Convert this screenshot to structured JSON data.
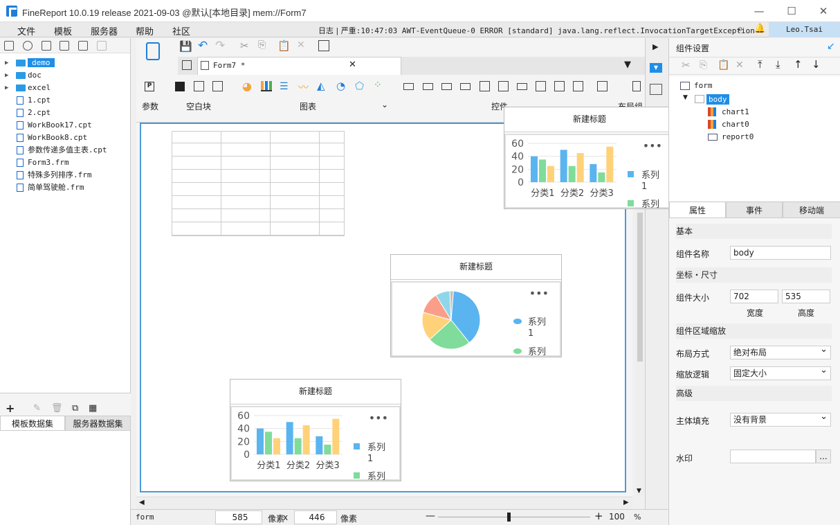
{
  "window": {
    "title": "FineReport 10.0.19 release 2021-09-03 @默认[本地目录]    mem://Form7"
  },
  "menu": [
    "文件",
    "模板",
    "服务器",
    "帮助",
    "社区"
  ],
  "log": {
    "label": "日志",
    "text": "严重:10:47:03 AWT-EventQueue-0 ERROR [standard] java.lang.reflect.InvocationTargetException"
  },
  "user": "Leo.Tsai",
  "tree": [
    {
      "name": "demo",
      "type": "folder",
      "selected": true
    },
    {
      "name": "doc",
      "type": "folder"
    },
    {
      "name": "excel",
      "type": "folder"
    },
    {
      "name": "1.cpt",
      "type": "cpt"
    },
    {
      "name": "2.cpt",
      "type": "cpt"
    },
    {
      "name": "WorkBook17.cpt",
      "type": "cpt"
    },
    {
      "name": "WorkBook8.cpt",
      "type": "cpt"
    },
    {
      "name": "参数传递多值主表.cpt",
      "type": "cpt"
    },
    {
      "name": "Form3.frm",
      "type": "frm"
    },
    {
      "name": "特殊多列排序.frm",
      "type": "frm"
    },
    {
      "name": "简单驾驶舱.frm",
      "type": "frm"
    }
  ],
  "datasets": {
    "template": "模板数据集",
    "server": "服务器数据集"
  },
  "tab": {
    "label": "Form7 *"
  },
  "groups": {
    "param": "参数",
    "blank": "空白块",
    "chart": "图表",
    "widget": "控件",
    "layout": "布局组"
  },
  "widgets": [
    {
      "title": "新建标题",
      "type": "bar",
      "yticks": [
        "60",
        "40",
        "20",
        "0"
      ],
      "categories": [
        "分类1",
        "分类2",
        "分类3"
      ],
      "legend": "系列1",
      "legend2": "系列"
    },
    {
      "title": "新建标题",
      "type": "pie",
      "legend": "系列1",
      "legend2": "系列"
    },
    {
      "title": "新建标题",
      "type": "bar",
      "yticks": [
        "60",
        "40",
        "20",
        "0"
      ],
      "categories": [
        "分类1",
        "分类2",
        "分类3"
      ],
      "legend": "系列1",
      "legend2": "系列"
    }
  ],
  "chart_data": [
    {
      "type": "bar",
      "title": "新建标题",
      "categories": [
        "分类1",
        "分类2",
        "分类3"
      ],
      "ylim": [
        0,
        60
      ],
      "series": [
        {
          "name": "系列1",
          "values": [
            40,
            50,
            28
          ]
        },
        {
          "values": [
            35,
            25,
            15
          ]
        },
        {
          "values": [
            25,
            45,
            55
          ]
        }
      ],
      "colors": [
        "#5ab4f0",
        "#7fdc9a",
        "#ffd27a"
      ]
    },
    {
      "type": "pie",
      "title": "新建标题",
      "values": [
        38,
        24,
        16,
        12,
        8,
        2
      ],
      "colors": [
        "#5ab4f0",
        "#7fdc9a",
        "#ffd27a",
        "#fa9e8a",
        "#8fd7e8",
        "#c0c0c0"
      ]
    },
    {
      "type": "bar",
      "title": "新建标题",
      "categories": [
        "分类1",
        "分类2",
        "分类3"
      ],
      "ylim": [
        0,
        60
      ],
      "series": [
        {
          "name": "系列1",
          "values": [
            40,
            50,
            28
          ]
        },
        {
          "values": [
            35,
            25,
            15
          ]
        },
        {
          "values": [
            25,
            45,
            55
          ]
        }
      ],
      "colors": [
        "#5ab4f0",
        "#7fdc9a",
        "#ffd27a"
      ]
    }
  ],
  "right": {
    "header": "组件设置",
    "tree": [
      "form",
      "body",
      "chart1",
      "chart0",
      "report0"
    ],
    "tabs": [
      "属性",
      "事件",
      "移动端"
    ],
    "basic": "基本",
    "nameLabel": "组件名称",
    "nameValue": "body",
    "coord": "坐标・尺寸",
    "sizeLabel": "组件大小",
    "width": "702",
    "height": "535",
    "widthLbl": "宽度",
    "heightLbl": "高度",
    "zoom": "组件区域缩放",
    "layoutLbl": "布局方式",
    "layoutVal": "绝对布局",
    "scaleLbl": "缩放逻辑",
    "scaleVal": "固定大小",
    "adv": "高级",
    "fillLbl": "主体填充",
    "fillVal": "没有背景",
    "watermark": "水印",
    "ellipsis": "..."
  },
  "status": {
    "name": "form",
    "x": "585",
    "unit1": "像素",
    "sep": "x",
    "y": "446",
    "unit2": "像素",
    "zoom": "100",
    "pct": "%"
  }
}
